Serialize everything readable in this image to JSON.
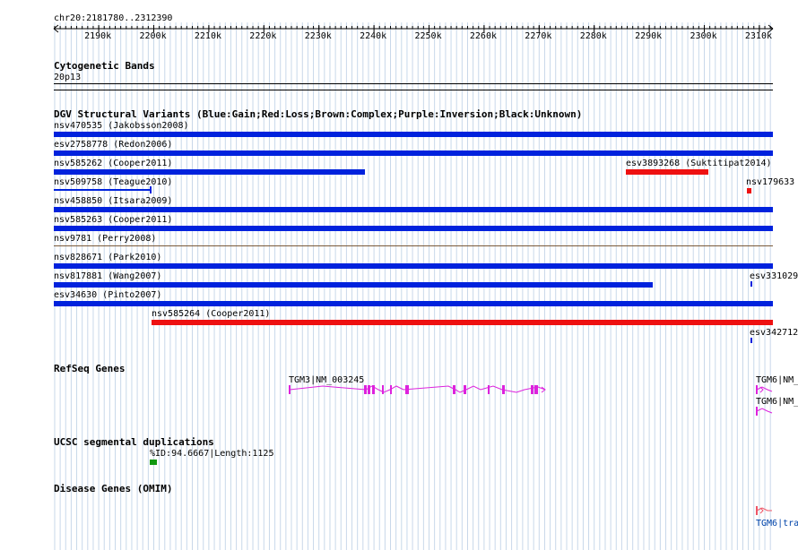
{
  "ruler": {
    "region": "chr20:2181780..2312390",
    "ticks": [
      "2190k",
      "2200k",
      "2210k",
      "2220k",
      "2230k",
      "2240k",
      "2250k",
      "2260k",
      "2270k",
      "2280k",
      "2290k",
      "2300k",
      "2310k"
    ]
  },
  "colors": {
    "gain": "#0022dd",
    "loss": "#ee1111",
    "inversion_line": "#7a5a3a",
    "gene": "#dd22dd",
    "omim_gene": "#ee5566",
    "segdup": "#119911",
    "grid": "#c8d8ea"
  },
  "tracks": {
    "cytobands": {
      "title": "Cytogenetic Bands",
      "band": "20p13"
    },
    "dgv": {
      "title": "DGV Structural Variants (Blue:Gain;Red:Loss;Brown:Complex;Purple:Inversion;Black:Unknown)",
      "features": [
        {
          "label": "nsv470535 (Jakobsson2008)"
        },
        {
          "label": "esv2758778 (Redon2006)"
        },
        {
          "label": "nsv585262 (Cooper2011)"
        },
        {
          "label": "esv3893268 (Suktitipat2014)"
        },
        {
          "label": "nsv509758 (Teague2010)"
        },
        {
          "label": "nsv179633"
        },
        {
          "label": "nsv458850 (Itsara2009)"
        },
        {
          "label": "nsv585263 (Cooper2011)"
        },
        {
          "label": "nsv9781 (Perry2008)"
        },
        {
          "label": "nsv828671 (Park2010)"
        },
        {
          "label": "nsv817881 (Wang2007)"
        },
        {
          "label": "esv331029"
        },
        {
          "label": "esv34630 (Pinto2007)"
        },
        {
          "label": "nsv585264 (Cooper2011)"
        },
        {
          "label": "esv342712"
        }
      ]
    },
    "refseq": {
      "title": "RefSeq Genes",
      "genes": [
        "TGM3|NM_003245",
        "TGM6|NM_",
        "TGM6|NM_"
      ]
    },
    "segdup": {
      "title": "UCSC segmental duplications",
      "label": "%ID:94.6667|Length:1125"
    },
    "omim": {
      "title": "Disease Genes (OMIM)",
      "gene": "TGM6|tra"
    }
  }
}
